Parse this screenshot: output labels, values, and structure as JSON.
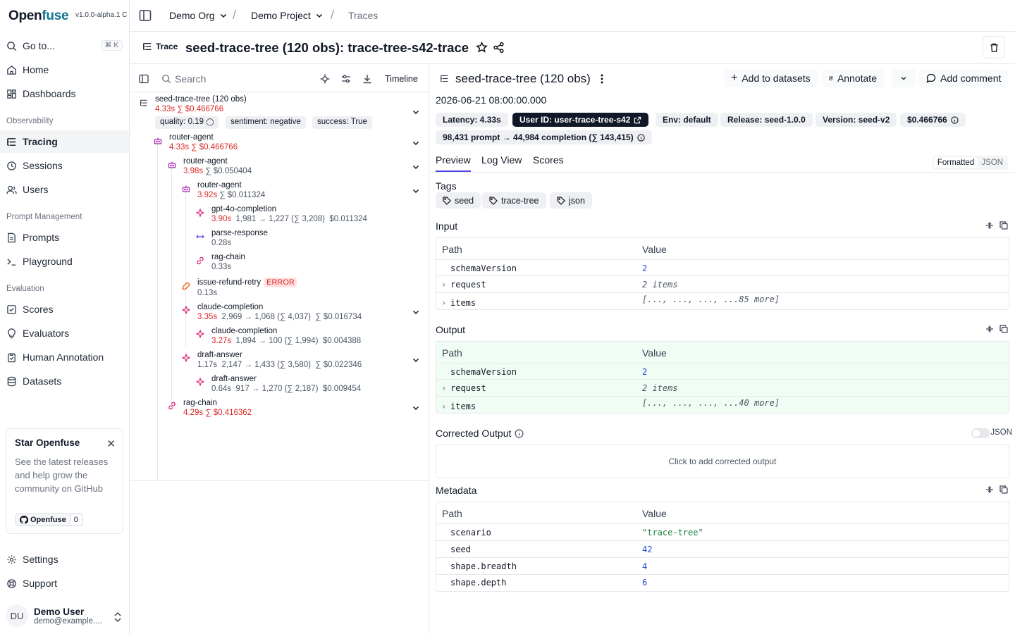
{
  "app": {
    "brand_open": "Open",
    "brand_fuse": "fuse",
    "version": "v1.0.0-alpha.1 C"
  },
  "sidebar": {
    "goto": "Go to...",
    "goto_kbd": "⌘ K",
    "items": [
      {
        "label": "Home",
        "icon": "home-icon"
      },
      {
        "label": "Dashboards",
        "icon": "dashboard-icon"
      }
    ],
    "sections": {
      "observability": "Observability",
      "prompt_management": "Prompt Management",
      "evaluation": "Evaluation"
    },
    "observability": [
      "Tracing",
      "Sessions",
      "Users"
    ],
    "prompt_management": [
      "Prompts",
      "Playground"
    ],
    "evaluation": [
      "Scores",
      "Evaluators",
      "Human Annotation",
      "Datasets"
    ],
    "settings": "Settings",
    "support": "Support"
  },
  "star_card": {
    "title": "Star Openfuse",
    "text": "See the latest releases and help grow the community on GitHub",
    "gh_label": "Openfuse",
    "gh_count": "0"
  },
  "user": {
    "initials": "DU",
    "name": "Demo User",
    "email": "demo@example...."
  },
  "breadcrumb": {
    "org": "Demo Org",
    "project": "Demo Project",
    "page": "Traces"
  },
  "trace": {
    "label": "Trace",
    "title": "seed-trace-tree (120 obs): trace-tree-s42-trace"
  },
  "tree_toolbar": {
    "search_placeholder": "Search",
    "timeline": "Timeline"
  },
  "tree": {
    "root": {
      "name": "seed-trace-tree (120 obs)",
      "latency": "4.33s",
      "cost": "∑ $0.466766",
      "scores": [
        "quality: 0.19",
        "sentiment: negative",
        "success: True"
      ]
    },
    "nodes": [
      {
        "name": "router-agent",
        "latency": "4.33s",
        "cost": "∑ $0.466766",
        "tokens": ""
      },
      {
        "name": "router-agent",
        "latency": "3.98s",
        "cost": "∑ $0.050404",
        "tokens": ""
      },
      {
        "name": "router-agent",
        "latency": "3.92s",
        "cost": "∑ $0.011324",
        "tokens": ""
      },
      {
        "name": "gpt-4o-completion",
        "latency": "3.90s",
        "tokens": "1,981 → 1,227 (∑ 3,208)",
        "cost": "$0.011324"
      },
      {
        "name": "parse-response",
        "latency": "0.28s",
        "tokens": "",
        "cost": ""
      },
      {
        "name": "rag-chain",
        "latency": "0.33s",
        "tokens": "",
        "cost": ""
      },
      {
        "name": "issue-refund-retry",
        "latency": "0.13s",
        "tokens": "",
        "cost": "",
        "error": "ERROR"
      },
      {
        "name": "claude-completion",
        "latency": "3.35s",
        "tokens": "2,969 → 1,068 (∑ 4,037)",
        "cost": "∑ $0.016734"
      },
      {
        "name": "claude-completion",
        "latency": "3.27s",
        "tokens": "1,894 → 100 (∑ 1,994)",
        "cost": "$0.004388"
      },
      {
        "name": "draft-answer",
        "latency": "1.17s",
        "tokens": "2,147 → 1,433 (∑ 3,580)",
        "cost": "∑ $0.022346"
      },
      {
        "name": "draft-answer",
        "latency": "0.64s",
        "tokens": "917 → 1,270 (∑ 2,187)",
        "cost": "$0.009454"
      },
      {
        "name": "rag-chain",
        "latency": "4.29s",
        "cost": "∑ $0.416362",
        "tokens": ""
      }
    ]
  },
  "detail": {
    "name": "seed-trace-tree (120 obs)",
    "buttons": {
      "datasets": "Add to datasets",
      "annotate": "Annotate",
      "comment": "Add comment"
    },
    "date": "2026-06-21 08:00:00.000",
    "badges": [
      "Latency: 4.33s",
      "User ID: user-trace-tree-s42",
      "Env: default",
      "Release: seed-1.0.0",
      "Version: seed-v2",
      "$0.466766"
    ],
    "tokens_badge": "98,431 prompt → 44,984 completion (∑ 143,415)",
    "tabs": [
      "Preview",
      "Log View",
      "Scores"
    ],
    "format": {
      "formatted": "Formatted",
      "json": "JSON"
    },
    "tags_label": "Tags",
    "tags": [
      "seed",
      "trace-tree",
      "json"
    ],
    "input_label": "Input",
    "output_label": "Output",
    "corrected_label": "Corrected Output",
    "corrected_placeholder": "Click to add corrected output",
    "corrected_json": "JSON",
    "metadata_label": "Metadata",
    "col_path": "Path",
    "col_value": "Value",
    "input_rows": [
      {
        "key": "schemaVersion",
        "value": "2",
        "type": "num",
        "caret": false
      },
      {
        "key": "request",
        "value": "2 items",
        "type": "ital",
        "caret": true
      },
      {
        "key": "items",
        "value": "[..., ..., ..., ...85 more]",
        "type": "ital",
        "caret": true
      }
    ],
    "output_rows": [
      {
        "key": "schemaVersion",
        "value": "2",
        "type": "num",
        "caret": false
      },
      {
        "key": "request",
        "value": "2 items",
        "type": "ital",
        "caret": true
      },
      {
        "key": "items",
        "value": "[..., ..., ..., ...40 more]",
        "type": "ital",
        "caret": true
      }
    ],
    "metadata_rows": [
      {
        "key": "scenario",
        "value": "\"trace-tree\"",
        "type": "str",
        "caret": false
      },
      {
        "key": "seed",
        "value": "42",
        "type": "num",
        "caret": false
      },
      {
        "key": "shape.breadth",
        "value": "4",
        "type": "num",
        "caret": false
      },
      {
        "key": "shape.depth",
        "value": "6",
        "type": "num",
        "caret": false
      }
    ]
  },
  "colors": {
    "accent": "#4f46e5",
    "brand": "#0e7490",
    "error": "#dc2626",
    "output_bg": "#f0fdf4"
  }
}
